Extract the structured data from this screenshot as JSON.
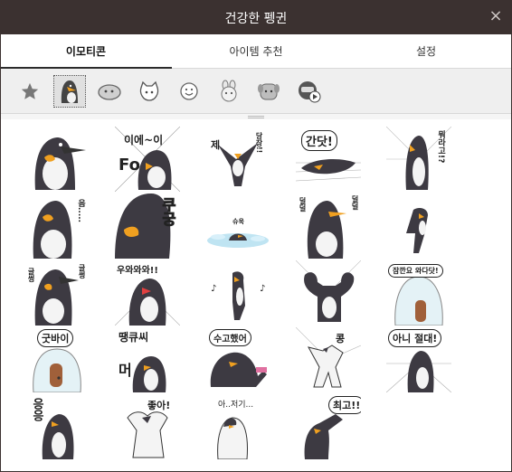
{
  "window": {
    "title": "건강한 펭귄",
    "close_symbol": "×"
  },
  "tabs": [
    {
      "label": "이모티콘"
    },
    {
      "label": "아이템 추천"
    },
    {
      "label": "설정"
    }
  ],
  "categories": [
    {
      "icon": "star-icon"
    },
    {
      "icon": "penguin-icon",
      "selected": true
    },
    {
      "icon": "blob-icon"
    },
    {
      "icon": "cat-icon"
    },
    {
      "icon": "smiley-icon"
    },
    {
      "icon": "bunny-icon"
    },
    {
      "icon": "dog-icon"
    },
    {
      "icon": "video-character-icon"
    }
  ],
  "stickers": {
    "r1c2": {
      "l1": "이에~이",
      "l2": "Fo"
    },
    "r1c3": {
      "l1": "제",
      "l2": "당장!!"
    },
    "r1c4": {
      "l1": "간닷!"
    },
    "r1c5": {
      "l1": "뭐라고!?"
    },
    "r2c1": {
      "l1": "음....."
    },
    "r2c2": {
      "l1": "쿠궁"
    },
    "r2c3": {
      "l1": "슈욱"
    },
    "r2c4": {
      "l1": "덜덜",
      "l2": "덜덜"
    },
    "r3c1": {
      "l1": "글썽",
      "l2": "글썽"
    },
    "r3c2": {
      "l1": "우와와와!!"
    },
    "r3c5": {
      "l1": "잠깐요 와다닷!"
    },
    "r4c1": {
      "l1": "굿바이"
    },
    "r4c2": {
      "l1": "땡큐씨",
      "l2": "머"
    },
    "r4c3": {
      "l1": "수고했어"
    },
    "r4c4": {
      "l1": "콩"
    },
    "r4c5": {
      "l1": "아니 절대!"
    },
    "r5c1": {
      "l1": "응응"
    },
    "r5c2": {
      "l1": "좋아!"
    },
    "r5c3": {
      "l1": "아..저기..."
    },
    "r5c4": {
      "l1": "최고!!"
    }
  }
}
